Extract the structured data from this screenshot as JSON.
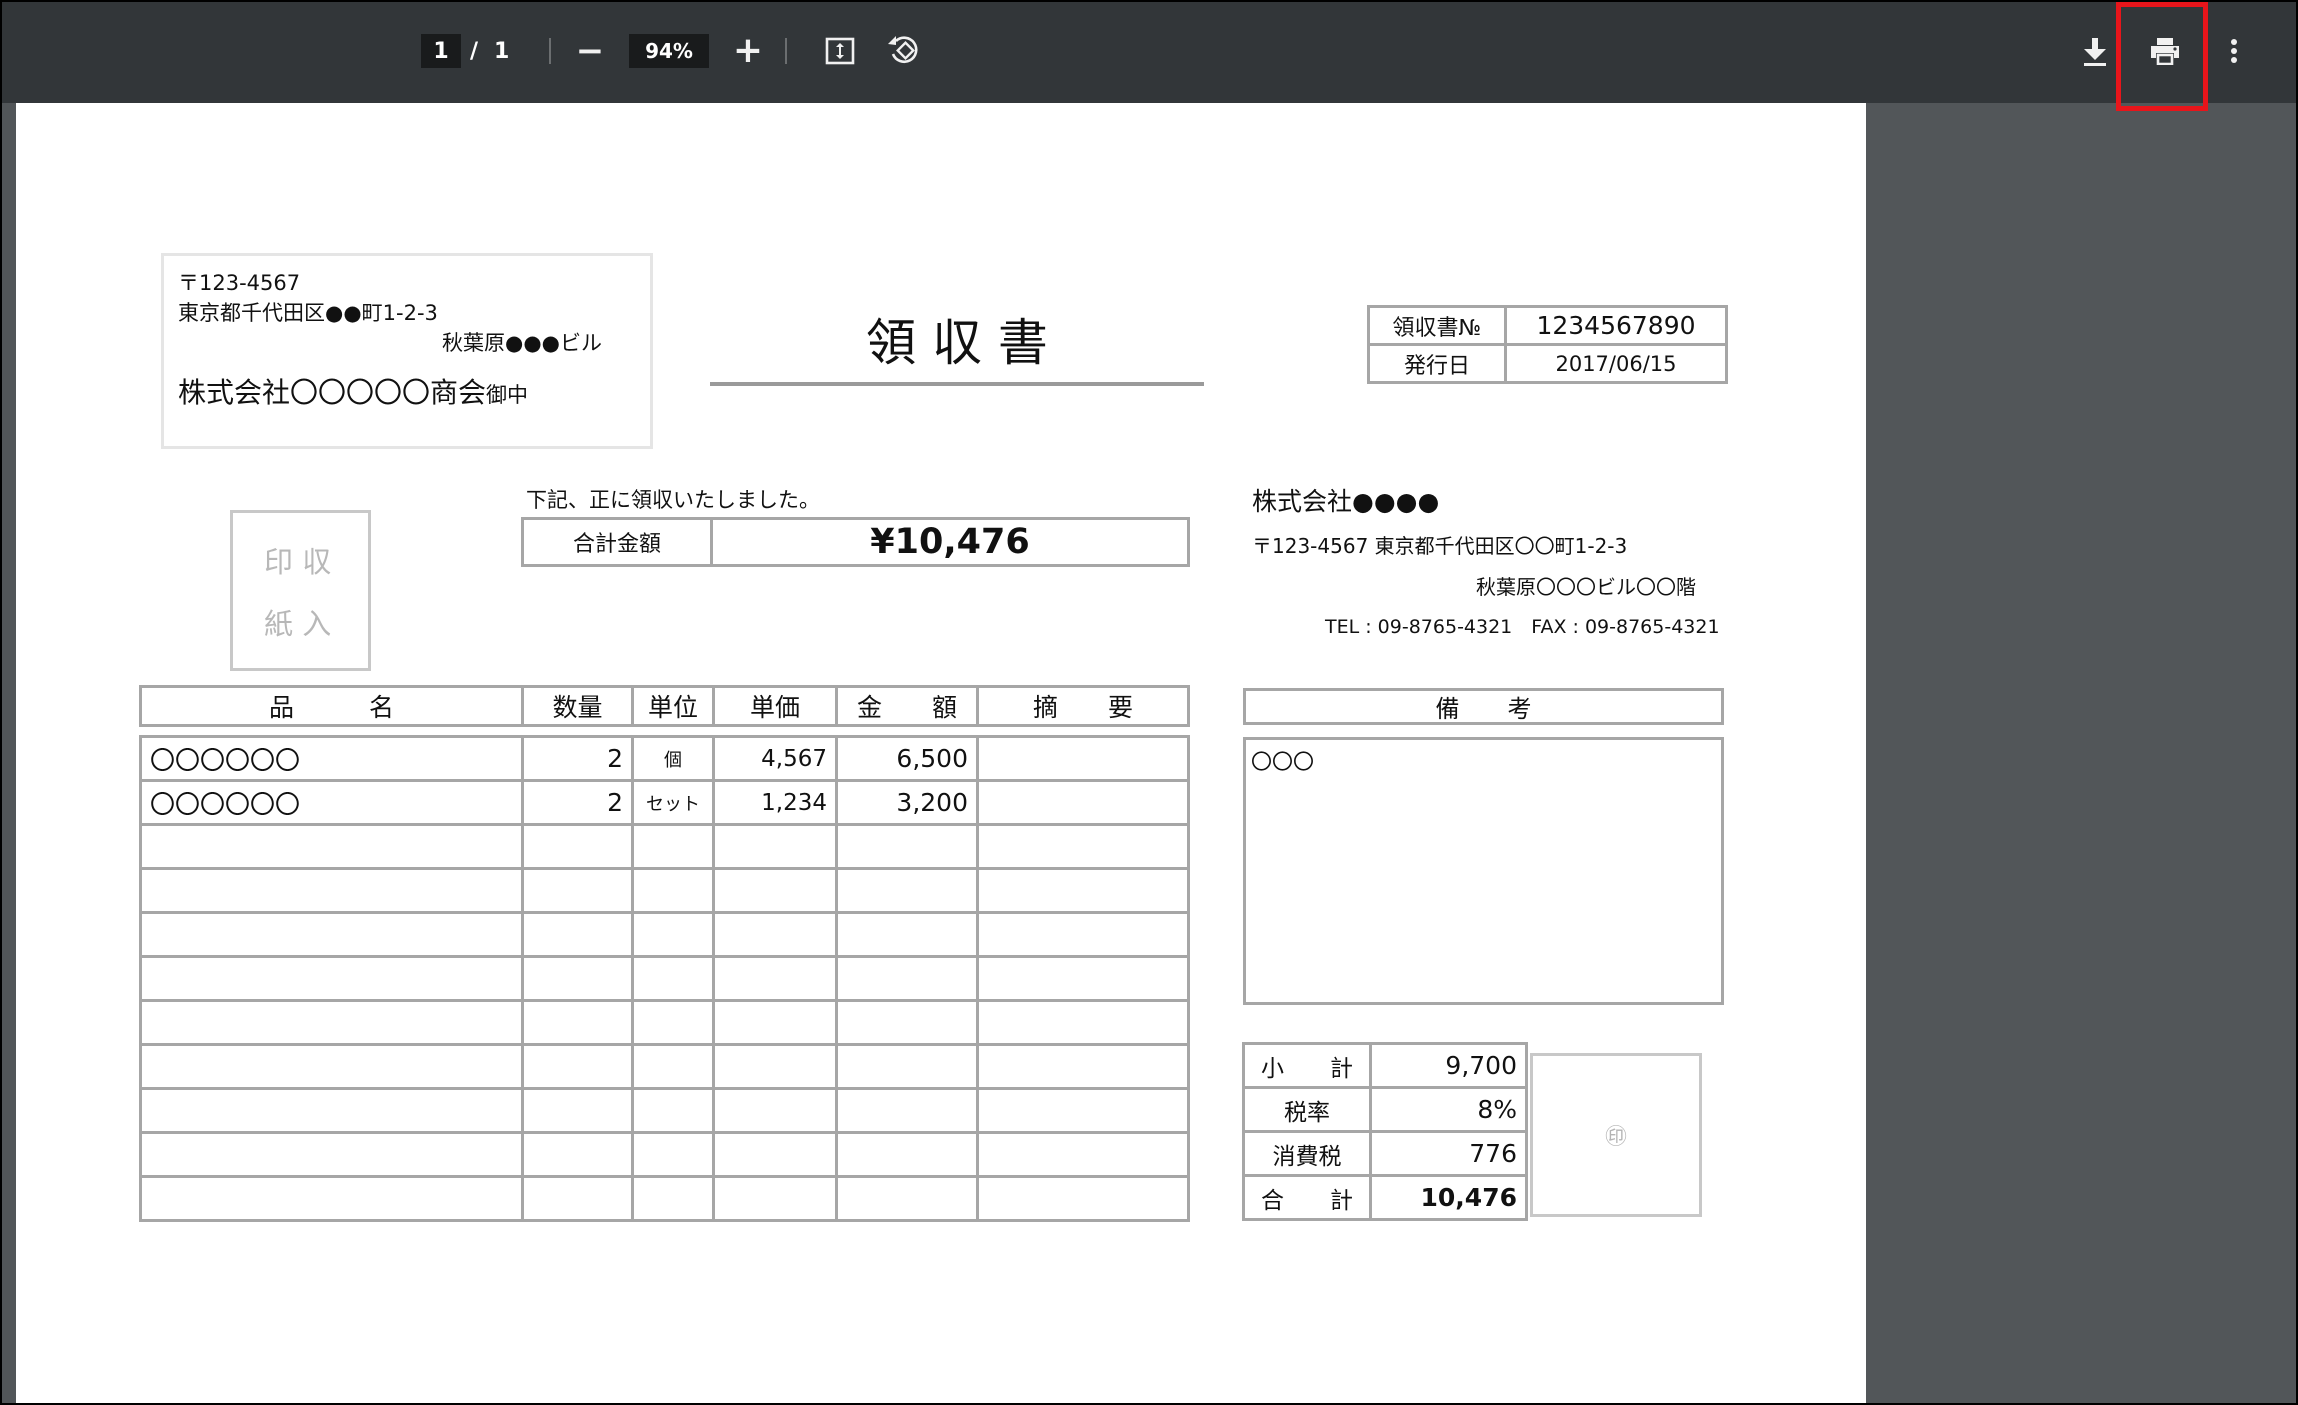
{
  "toolbar": {
    "page_current": "1",
    "page_separator": "/",
    "page_total": "1",
    "zoom_out_label": "−",
    "zoom_value": "94%",
    "zoom_in_label": "+"
  },
  "receipt": {
    "recipient": {
      "postal": "〒123-4567",
      "address1": "東京都千代田区●●町1-2-3",
      "address2": "秋葉原●●●ビル",
      "company": "株式会社〇〇〇〇〇商会",
      "honorific": "御中"
    },
    "title": "領 収 書",
    "meta": {
      "no_label": "領収書№",
      "no_value": "1234567890",
      "date_label": "発行日",
      "date_value": "2017/06/15"
    },
    "stamp_box": {
      "line1": "印 収",
      "line2": "紙 入"
    },
    "note": "下記、正に領収いたしました。",
    "total": {
      "label": "合計金額",
      "value": "¥10,476"
    },
    "issuer": {
      "company": "株式会社●●●●",
      "address": "〒123-4567 東京都千代田区〇〇町1-2-3",
      "building": "秋葉原〇〇〇ビル〇〇階",
      "contact": "TEL : 09-8765-4321　FAX : 09-8765-4321"
    },
    "items_header": {
      "name": "品　　　名",
      "qty": "数量",
      "unit": "単位",
      "price": "単価",
      "amount": "金　　額",
      "summary": "摘　　要"
    },
    "items": [
      {
        "name": "〇〇〇〇〇〇",
        "qty": "2",
        "unit": "個",
        "price": "4,567",
        "amount": "6,500",
        "summary": ""
      },
      {
        "name": "〇〇〇〇〇〇",
        "qty": "2",
        "unit": "セット",
        "price": "1,234",
        "amount": "3,200",
        "summary": ""
      }
    ],
    "remarks": {
      "header": "備　　考",
      "content": "〇〇〇"
    },
    "totals": {
      "subtotal_label": "小　　計",
      "subtotal_value": "9,700",
      "taxrate_label": "税率",
      "taxrate_value": "8%",
      "tax_label": "消費税",
      "tax_value": "776",
      "total_label": "合　　計",
      "total_value": "10,476"
    },
    "seal": "㊞"
  }
}
